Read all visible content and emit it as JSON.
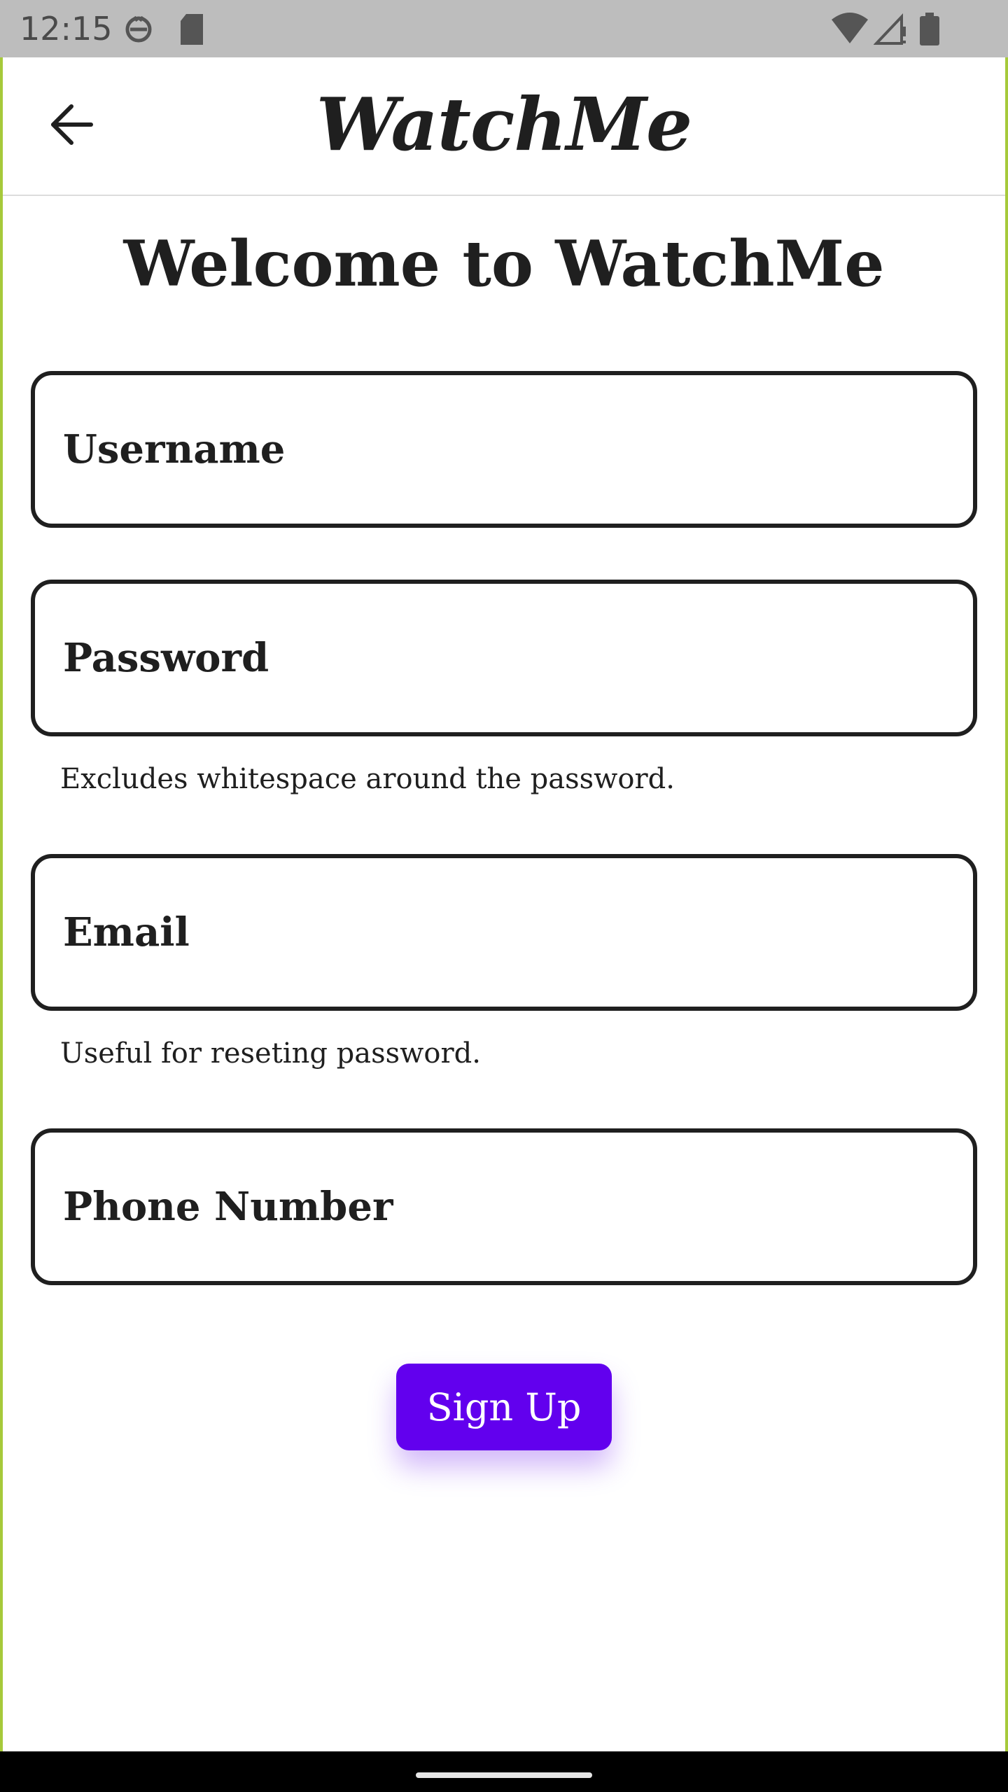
{
  "status_bar": {
    "time": "12:15"
  },
  "app_bar": {
    "title": "WatchMe",
    "back_icon": "arrow-back-icon"
  },
  "page": {
    "heading": "Welcome to WatchMe"
  },
  "form": {
    "username": {
      "value": "",
      "placeholder": "Username"
    },
    "password": {
      "value": "",
      "placeholder": "Password",
      "helper": "Excludes whitespace around the password."
    },
    "email": {
      "value": "",
      "placeholder": "Email",
      "helper": "Useful for reseting password."
    },
    "phone": {
      "value": "",
      "placeholder": "Phone Number"
    },
    "submit_label": "Sign Up"
  },
  "colors": {
    "accent": "#6200ee",
    "status_bar": "#bdbdbd",
    "frame_border": "#a6c93a",
    "text": "#1f1f1f"
  }
}
